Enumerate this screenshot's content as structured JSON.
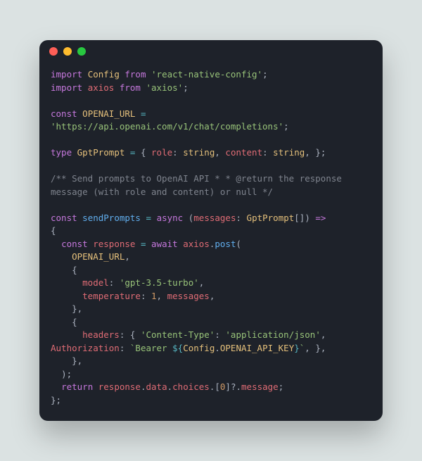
{
  "code": {
    "l1": {
      "kw_import": "import",
      "name": "Config",
      "kw_from": "from",
      "str": "'react-native-config'",
      "semi": ";"
    },
    "l2": {
      "kw_import": "import",
      "name": "axios",
      "kw_from": "from",
      "str": "'axios'",
      "semi": ";"
    },
    "l4": {
      "kw_const": "const",
      "name": "OPENAI_URL",
      "eq": "="
    },
    "l5": {
      "str": "'https://api.openai.com/v1/chat/completions'",
      "semi": ";"
    },
    "l7": {
      "kw_type": "type",
      "name": "GptPrompt",
      "eq": "=",
      "ob": "{",
      "role": "role",
      "c1": ":",
      "str1": "string",
      "cm1": ",",
      "content": "content",
      "c2": ":",
      "str2": "string",
      "cm2": ",",
      "cb": "}",
      "semi": ";"
    },
    "l9": {
      "comment": "/** Send prompts to OpenAI API * * @return the response message (with role and content) or null */"
    },
    "l11": {
      "kw_const": "const",
      "name": "sendPrompts",
      "eq": "=",
      "kw_async": "async",
      "op": "(",
      "param": "messages",
      "c": ":",
      "type": "GptPrompt",
      "arr": "[]",
      "cp": ")",
      "arrow": "=>"
    },
    "l12": {
      "ob": "{"
    },
    "l13": {
      "indent": "  ",
      "kw_const": "const",
      "name": "response",
      "eq": "=",
      "kw_await": "await",
      "obj": "axios",
      "dot": ".",
      "method": "post",
      "op": "("
    },
    "l14": {
      "indent": "    ",
      "name": "OPENAI_URL",
      "cm": ","
    },
    "l15": {
      "indent": "    ",
      "ob": "{"
    },
    "l16": {
      "indent": "      ",
      "key": "model",
      "c": ":",
      "str": "'gpt-3.5-turbo'",
      "cm": ","
    },
    "l17": {
      "indent": "      ",
      "key": "temperature",
      "c": ":",
      "num": "1",
      "cm1": ",",
      "key2": "messages",
      "cm2": ","
    },
    "l18": {
      "indent": "    ",
      "cb": "}",
      "cm": ","
    },
    "l19": {
      "indent": "    ",
      "ob": "{"
    },
    "l20": {
      "indent": "      ",
      "key": "headers",
      "c": ":",
      "ob": "{",
      "k1": "'Content-Type'",
      "c1": ":",
      "v1": "'application/json'",
      "cm": ","
    },
    "l21": {
      "key": "Authorization",
      "c": ":",
      "bt1": "`Bearer ",
      "dl": "${",
      "obj": "Config",
      "dot": ".",
      "prop": "OPENAI_API_KEY",
      "dr": "}",
      "bt2": "`",
      "cm": ",",
      "cb": "}",
      "cm2": ","
    },
    "l22": {
      "indent": "    ",
      "cb": "}",
      "cm": ","
    },
    "l23": {
      "indent": "  ",
      "cp": ")",
      "semi": ";"
    },
    "l24": {
      "indent": "  ",
      "kw_return": "return",
      "obj": "response",
      "d1": ".",
      "p1": "data",
      "d2": ".",
      "p2": "choices",
      "d3": ".",
      "ob": "[",
      "num": "0",
      "cb": "]",
      "opt": "?.",
      "p3": "message",
      "semi": ";"
    },
    "l25": {
      "cb": "}",
      "semi": ";"
    }
  }
}
